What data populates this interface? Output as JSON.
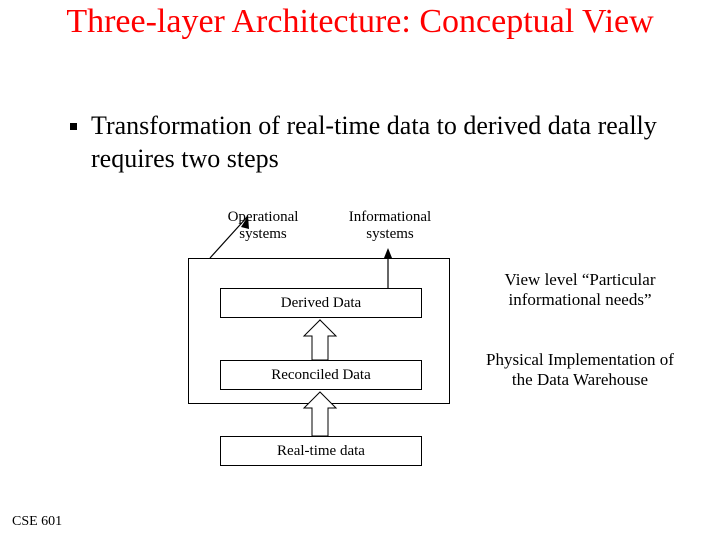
{
  "title": "Three-layer Architecture: Conceptual View",
  "bullet": "Transformation of real-time data to derived data really requires two steps",
  "labels": {
    "operational": "Operational\nsystems",
    "informational": "Informational\nsystems"
  },
  "boxes": {
    "derived": "Derived Data",
    "reconciled": "Reconciled Data",
    "realtime": "Real-time data"
  },
  "side": {
    "view_level": "View level\n“Particular informational needs”",
    "physical": "Physical Implementation of the Data Warehouse"
  },
  "footer": "CSE 601"
}
